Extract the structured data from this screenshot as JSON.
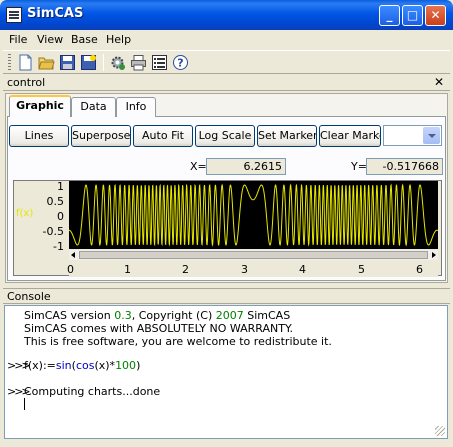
{
  "window": {
    "title": "SimCAS",
    "minimize": "_",
    "maximize": "□",
    "close": "✕"
  },
  "menu": [
    "File",
    "View",
    "Base",
    "Help"
  ],
  "toolbar": {
    "icons": [
      "new-file-icon",
      "open-folder-icon",
      "save-icon",
      "save-all-icon",
      "settings-icon",
      "print-icon",
      "list-icon",
      "help-icon"
    ]
  },
  "control_panel": {
    "title": "control",
    "close": "✕",
    "tabs": [
      {
        "label": "Graphic",
        "active": true
      },
      {
        "label": "Data",
        "active": false
      },
      {
        "label": "Info",
        "active": false
      }
    ],
    "buttons": [
      "Lines",
      "Superpose",
      "Auto Fit",
      "Log Scale",
      "Set Marker",
      "Clear Marker"
    ],
    "combo_value": "",
    "x_label": "X=",
    "x_value": "6.2615",
    "y_label": "Y=",
    "y_value": "-0.517668"
  },
  "chart_data": {
    "type": "line",
    "series": [
      {
        "name": "f(x)",
        "color": "#e6e600"
      }
    ],
    "function": "f(x):=sin(cos(x)*100)",
    "xlim": [
      0,
      6.3
    ],
    "ylim": [
      -1,
      1
    ],
    "y_ticks": [
      "1",
      "0.5",
      "0",
      "-0.5",
      "-1"
    ],
    "x_ticks": [
      "0",
      "1",
      "2",
      "3",
      "4",
      "5",
      "6"
    ],
    "background": "#000000",
    "grid": false
  },
  "console": {
    "title": "Console",
    "lines": [
      {
        "prefix": "SimCAS version ",
        "green": "0.3",
        "mid": ", Copyright (C) ",
        "green2": "2007",
        "suffix": " SimCAS"
      },
      {
        "text": "SimCAS comes with ABSOLUTELY NO WARRANTY."
      },
      {
        "text": "This is free software, you are welcome to redistribute it."
      }
    ],
    "prompt": ">>>",
    "input": {
      "a": "f(x):=",
      "b": "sin",
      "c": "(",
      "d": "cos",
      "e": "(x)*",
      "f": "100",
      "g": ")"
    },
    "output": "Computing charts...done"
  }
}
